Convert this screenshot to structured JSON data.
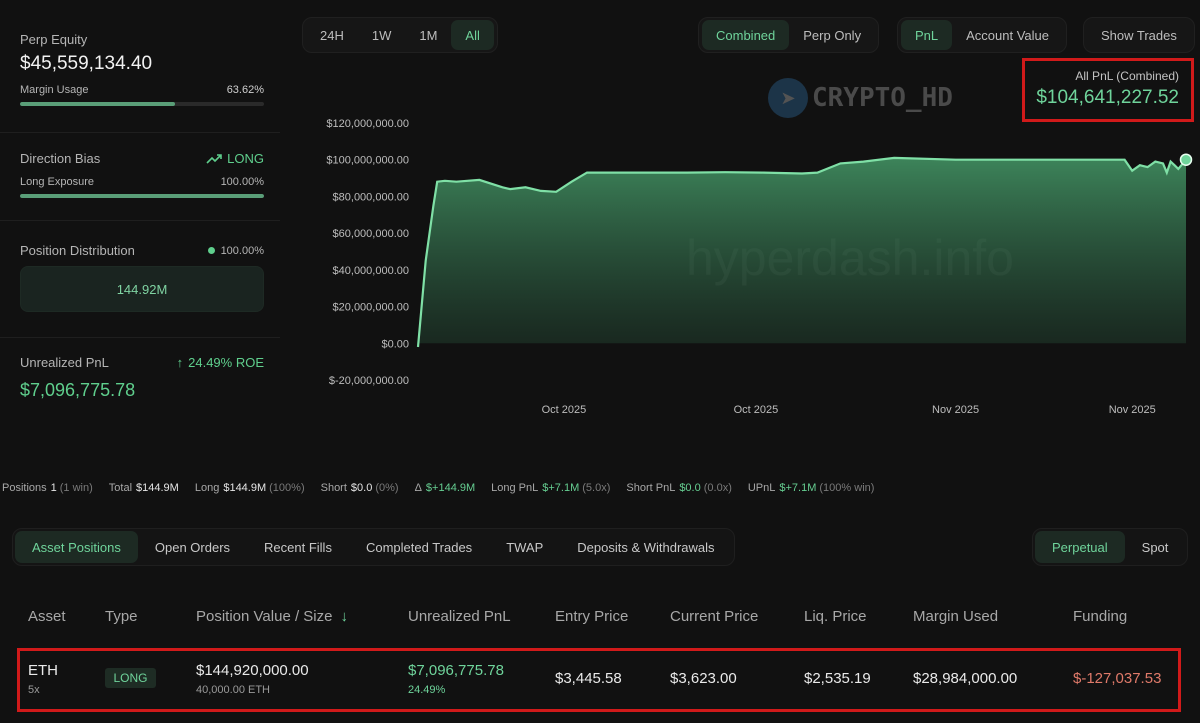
{
  "left": {
    "perp_equity_label": "Perp Equity",
    "perp_equity_value": "$45,559,134.40",
    "margin_usage_label": "Margin Usage",
    "margin_usage_value": "63.62%",
    "margin_usage_fraction": 0.6362,
    "direction_bias_label": "Direction Bias",
    "direction_bias_value": "LONG",
    "long_exposure_label": "Long Exposure",
    "long_exposure_value": "100.00%",
    "long_exposure_fraction": 1.0,
    "position_distribution_label": "Position Distribution",
    "position_distribution_pct": "100.00%",
    "position_distribution_amount": "144.92M",
    "unrealized_pnl_label": "Unrealized PnL",
    "unrealized_pnl_roe": "24.49% ROE",
    "unrealized_pnl_value": "$7,096,775.78"
  },
  "toolbar": {
    "ranges": [
      "24H",
      "1W",
      "1M",
      "All"
    ],
    "range_active": "All",
    "mode": [
      "Combined",
      "Perp Only"
    ],
    "mode_active": "Combined",
    "metric": [
      "PnL",
      "Account Value"
    ],
    "metric_active": "PnL",
    "show_trades": "Show Trades"
  },
  "pnl_box": {
    "title": "All PnL (Combined)",
    "value": "$104,641,227.52"
  },
  "watermark": {
    "logo_text": "CRYPTO_HD",
    "site": "hyperdash.info"
  },
  "colors": {
    "accent_green": "#6fd49b",
    "negative": "#e07a6a",
    "highlight_red": "#d11a1a",
    "background": "#111111"
  },
  "chart_data": {
    "type": "area",
    "ylim": [
      -20000000,
      120000000
    ],
    "y_ticks": [
      "$120,000,000.00",
      "$100,000,000.00",
      "$80,000,000.00",
      "$60,000,000.00",
      "$40,000,000.00",
      "$20,000,000.00",
      "$0.00",
      "$-20,000,000.00"
    ],
    "y_tick_values": [
      120000000,
      100000000,
      80000000,
      60000000,
      40000000,
      20000000,
      0,
      -20000000
    ],
    "x_ticks": [
      "Oct 2025",
      "Oct 2025",
      "Nov 2025",
      "Nov 2025"
    ],
    "x_tick_positions": [
      0.19,
      0.44,
      0.7,
      0.93
    ],
    "x": [
      0,
      0.01,
      0.02,
      0.025,
      0.035,
      0.05,
      0.08,
      0.11,
      0.12,
      0.14,
      0.16,
      0.18,
      0.2,
      0.22,
      0.25,
      0.3,
      0.35,
      0.4,
      0.45,
      0.5,
      0.52,
      0.55,
      0.58,
      0.62,
      0.7,
      0.78,
      0.82,
      0.86,
      0.88,
      0.9,
      0.92,
      0.93,
      0.94,
      0.95,
      0.96,
      0.97,
      0.975,
      0.98,
      0.985,
      0.99,
      1.0
    ],
    "values": [
      -2000000,
      45000000,
      75000000,
      88000000,
      88500000,
      88000000,
      89000000,
      85000000,
      84000000,
      85000000,
      83000000,
      82500000,
      88000000,
      93000000,
      93000000,
      93000000,
      93000000,
      93200000,
      93000000,
      92500000,
      93000000,
      98000000,
      99000000,
      101000000,
      100000000,
      100000000,
      100000000,
      100000000,
      100000000,
      100000000,
      100000000,
      94000000,
      97000000,
      96000000,
      99000000,
      98000000,
      93000000,
      99000000,
      97000000,
      95000000,
      100000000,
      104641227
    ]
  },
  "summary": {
    "positions_label": "Positions",
    "positions_value": "1",
    "positions_meta": "(1 win)",
    "total_label": "Total",
    "total_value": "$144.9M",
    "long_label": "Long",
    "long_value": "$144.9M",
    "long_meta": "(100%)",
    "short_label": "Short",
    "short_value": "$0.0",
    "short_meta": "(0%)",
    "delta_label": "Δ",
    "delta_value": "$+144.9M",
    "long_pnl_label": "Long PnL",
    "long_pnl_value": "$+7.1M",
    "long_pnl_meta": "(5.0x)",
    "short_pnl_label": "Short PnL",
    "short_pnl_value": "$0.0",
    "short_pnl_meta": "(0.0x)",
    "upnl_label": "UPnL",
    "upnl_value": "$+7.1M",
    "upnl_meta": "(100% win)"
  },
  "tabs": [
    "Asset Positions",
    "Open Orders",
    "Recent Fills",
    "Completed Trades",
    "TWAP",
    "Deposits & Withdrawals"
  ],
  "tab_active": "Asset Positions",
  "market_tabs": [
    "Perpetual",
    "Spot"
  ],
  "market_tab_active": "Perpetual",
  "table": {
    "headers": {
      "asset": "Asset",
      "type": "Type",
      "position_value": "Position Value / Size",
      "sort_arrow": "↓",
      "unrealized_pnl": "Unrealized PnL",
      "entry_price": "Entry Price",
      "current_price": "Current Price",
      "liq_price": "Liq. Price",
      "margin_used": "Margin Used",
      "funding": "Funding"
    },
    "row": {
      "asset": "ETH",
      "leverage": "5x",
      "type": "LONG",
      "position_value": "$144,920,000.00",
      "size": "40,000.00 ETH",
      "unrealized_pnl": "$7,096,775.78",
      "unrealized_pnl_pct": "24.49%",
      "entry_price": "$3,445.58",
      "current_price": "$3,623.00",
      "liq_price": "$2,535.19",
      "margin_used": "$28,984,000.00",
      "funding": "$-127,037.53"
    }
  }
}
